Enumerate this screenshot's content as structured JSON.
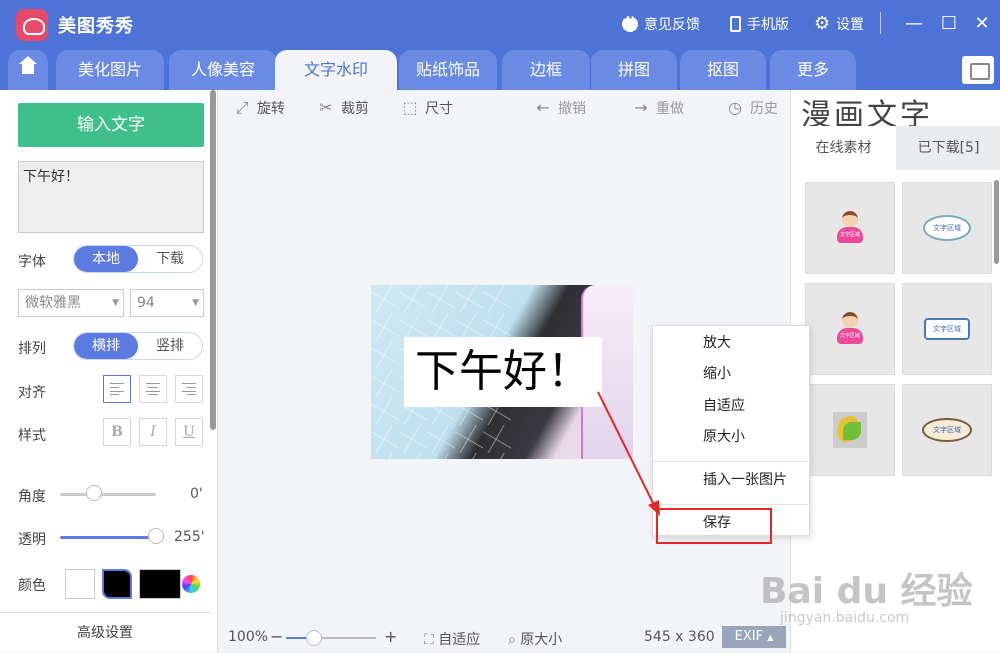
{
  "app": {
    "name": "美图秀秀"
  },
  "titlebar": {
    "feedback": "意见反馈",
    "mobile": "手机版",
    "settings": "设置"
  },
  "tabs": [
    "美化图片",
    "人像美容",
    "文字水印",
    "贴纸饰品",
    "边框",
    "拼图",
    "抠图",
    "更多"
  ],
  "active_tab": "文字水印",
  "left": {
    "input_text_button": "输入文字",
    "text_value": "下午好！",
    "font_label": "字体",
    "font_source": {
      "local": "本地",
      "download": "下载"
    },
    "font_name": "微软雅黑",
    "font_size": "94",
    "layout_label": "排列",
    "layout": {
      "horizontal": "横排",
      "vertical": "竖排"
    },
    "align_label": "对齐",
    "style_label": "样式",
    "style_buttons": [
      "B",
      "I",
      "U"
    ],
    "angle_label": "角度",
    "angle_value": "0'",
    "angle_fraction": 0.35,
    "opacity_label": "透明",
    "opacity_value": "255'",
    "opacity_fraction": 1.0,
    "color_label": "颜色",
    "advanced": "高级设置"
  },
  "toolbar": {
    "rotate": "旋转",
    "crop": "裁剪",
    "size": "尺寸",
    "undo": "撤销",
    "redo": "重做",
    "history": "历史"
  },
  "canvas": {
    "overlay_text": "下午好！"
  },
  "context_menu": {
    "items": [
      "放大",
      "缩小",
      "自适应",
      "原大小"
    ],
    "insert": "插入一张图片",
    "save": "保存"
  },
  "bottombar": {
    "zoom": "100%",
    "fit": "自适应",
    "original": "原大小",
    "dimensions": "545 x 360",
    "exif": "EXIF"
  },
  "right": {
    "title": "漫画文字",
    "tab_online": "在线素材",
    "tab_downloaded": "已下载[5]",
    "thumbnails": [
      "文字区域",
      "文字区域",
      "文字区域",
      "文字区域",
      "",
      "文字区域"
    ]
  },
  "watermark": {
    "main": "Bai du 经验",
    "sub": "jingyan.baidu.com"
  },
  "colors": {
    "brand": "#4e73d6",
    "green": "#3fc08a",
    "highlight": "#e02a2a"
  }
}
